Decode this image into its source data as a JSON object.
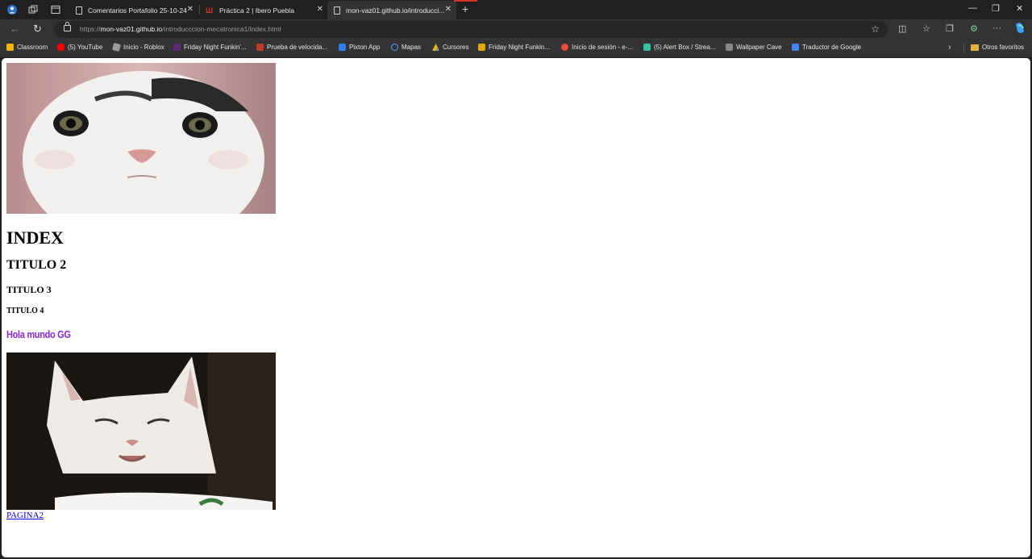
{
  "browser": {
    "tabs": [
      {
        "label": "Comentarios Portafolio 25-10-24"
      },
      {
        "label": "Práctica 2 | Ibero Puebla"
      },
      {
        "label": "mon-vaz01.github.io/introducci..."
      }
    ],
    "url_prefix": "https://",
    "url_host": "mon-vaz01.github.io",
    "url_path": "/introducccion-mecatronica1/index.html",
    "bookmarks": [
      "Classroom",
      "(5) YouTube",
      "Inicio - Roblox",
      "Friday Night Funkin'...",
      "Prueba de velocida...",
      "Pixton App",
      "Mapas",
      "Cursores",
      "Friday Night Funkin...",
      "Inicio de sesión - e-...",
      "(5) Alert Box / Strea...",
      "Wallpaper Cave",
      "Traductor de Google"
    ],
    "other_favorites": "Otros favoritos"
  },
  "page": {
    "h1": "INDEX",
    "h2": "TITULO 2",
    "h3": "TITULO 3",
    "h4": "TITULO 4",
    "colored_text": "Hola mundo GG",
    "link": "PAGINA2"
  },
  "colors": {
    "colored_text": "#8a2be2",
    "link": "#0000ee"
  }
}
